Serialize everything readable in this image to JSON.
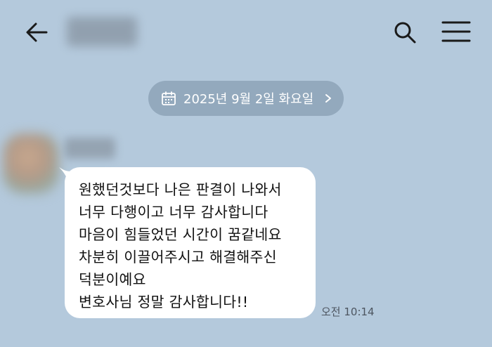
{
  "header": {
    "back_icon": "arrow-left-icon",
    "search_icon": "search-icon",
    "menu_icon": "hamburger-menu-icon"
  },
  "date_divider": {
    "icon": "calendar-icon",
    "text": "2025년 9월 2일 화요일",
    "chevron_icon": "chevron-right-icon"
  },
  "message": {
    "lines": [
      "원했던것보다 나은 판결이 나와서",
      "너무 다행이고 너무 감사합니다",
      "마음이 힘들었던 시간이 꿈같네요",
      "차분히 이끌어주시고 해결해주신",
      "덕분이예요",
      "변호사님 정말 감사합니다!!"
    ],
    "time": "오전 10:14"
  },
  "colors": {
    "background": "#b4c9dc",
    "bubble": "#ffffff",
    "date_pill": "#93a9bd"
  }
}
